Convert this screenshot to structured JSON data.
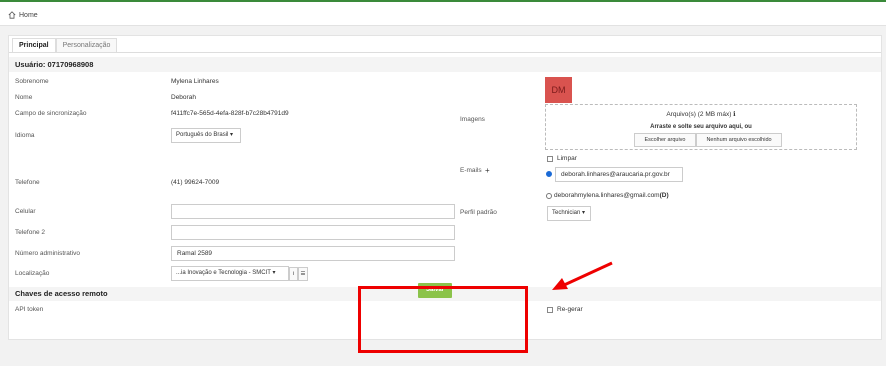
{
  "breadcrumb": {
    "home_label": "Home"
  },
  "tabs": [
    {
      "label": "Principal"
    },
    {
      "label": "Personalização"
    }
  ],
  "user_section": {
    "title": "Usuário: 07170968908"
  },
  "fields": {
    "surname": {
      "label": "Sobrenome",
      "value": "Mylena Linhares"
    },
    "name": {
      "label": "Nome",
      "value": "Deborah"
    },
    "sync_field": {
      "label": "Campo de sincronização",
      "value": "f411ffc7e-565d-4efa-828f-b7c28b4791d9"
    },
    "language": {
      "label": "Idioma",
      "value": "Português do Brasil"
    },
    "phone": {
      "label": "Telefone",
      "value": "(41) 99624-7009"
    },
    "mobile": {
      "label": "Celular",
      "value": ""
    },
    "phone2": {
      "label": "Telefone 2",
      "value": ""
    },
    "admin_number": {
      "label": "Número administrativo",
      "value": "Ramal 2589"
    },
    "location": {
      "label": "Localização",
      "value": "...ia Inovação e Tecnologia - SMCIT"
    }
  },
  "images": {
    "label": "Imagens",
    "avatar_initials": "DM",
    "upload_title": "Arquivo(s) (2 MB máx)",
    "upload_info_icon": "info-icon",
    "drop_text": "Arraste e solte seu arquivo aqui, ou",
    "choose_button": "Escolher arquivo",
    "no_file_text": "Nenhum arquivo escolhido",
    "clear_label": "Limpar"
  },
  "emails": {
    "label": "E-mails",
    "add_icon": "plus-icon",
    "primary": "deborah.linhares@araucaria.pr.gov.br",
    "secondary": "deborahmylena.linhares@gmail.com",
    "secondary_suffix": "(D)"
  },
  "profile": {
    "label": "Perfil padrão",
    "value": "Technician"
  },
  "remote_section": {
    "title": "Chaves de acesso remoto"
  },
  "api": {
    "label": "API token",
    "regen_label": "Re-gerar"
  },
  "save_button": "Salvar",
  "colors": {
    "accent_green": "#8bc34a",
    "highlight_red": "#e00000",
    "avatar_red": "#d9534f",
    "top_border_green": "#3a8a3a"
  }
}
